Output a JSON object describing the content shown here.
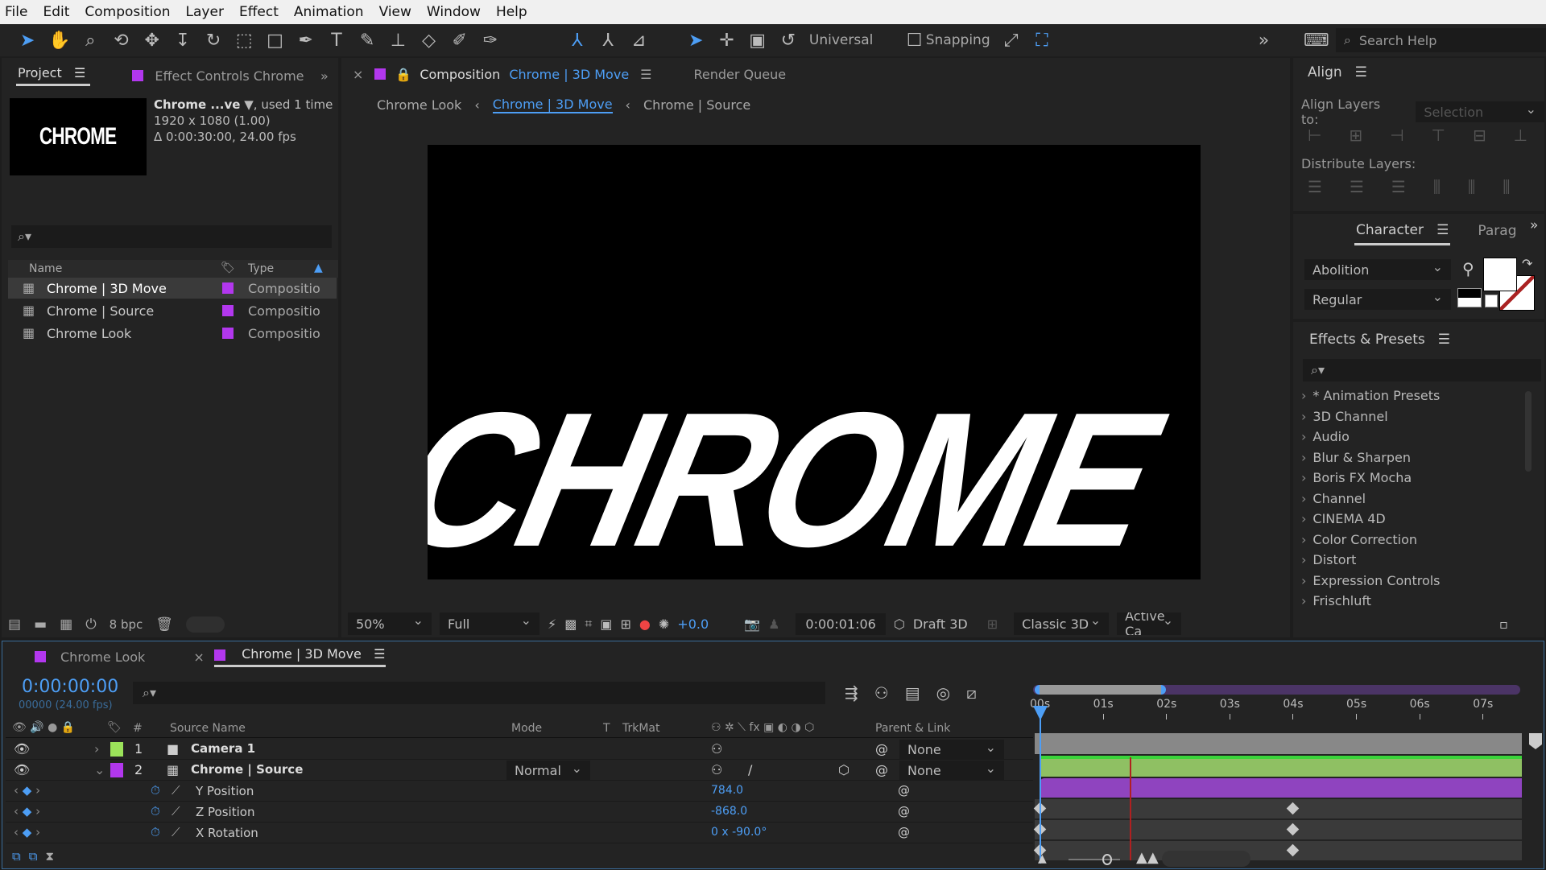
{
  "menu": [
    "File",
    "Edit",
    "Composition",
    "Layer",
    "Effect",
    "Animation",
    "View",
    "Window",
    "Help"
  ],
  "toolbar": {
    "universal": "Universal",
    "snapping": "Snapping",
    "search_placeholder": "Search Help"
  },
  "project": {
    "tab": "Project",
    "effect_controls_tab": "Effect Controls Chrome",
    "thumb_text": "CHROME",
    "info": {
      "name": "Chrome ...ve",
      "used": ", used 1 time",
      "size": "1920 x 1080 (1.00)",
      "duration": "Δ 0:00:30:00, 24.00 fps"
    },
    "columns": {
      "name": "Name",
      "type": "Type"
    },
    "items": [
      {
        "name": "Chrome | 3D Move",
        "type": "Compositio",
        "selected": true
      },
      {
        "name": "Chrome | Source",
        "type": "Compositio"
      },
      {
        "name": "Chrome Look",
        "type": "Compositio"
      }
    ],
    "bpc": "8 bpc"
  },
  "viewer": {
    "tab_prefix": "Composition",
    "tab_name": "Chrome | 3D Move",
    "render_queue": "Render Queue",
    "breadcrumbs": [
      "Chrome Look",
      "Chrome | 3D Move",
      "Chrome | Source"
    ],
    "canvas_text": "CHROME",
    "zoom": "50%",
    "resolution": "Full",
    "exposure": "+0.0",
    "timecode": "0:00:01:06",
    "draft3d": "Draft 3D",
    "renderer": "Classic 3D",
    "view": "Active Ca"
  },
  "align": {
    "title": "Align",
    "align_to": "Align Layers to:",
    "align_to_value": "Selection",
    "distribute": "Distribute Layers:"
  },
  "character": {
    "tab": "Character",
    "para_tab": "Parag",
    "font": "Abolition",
    "style": "Regular",
    "fill": "#ffffff"
  },
  "effects": {
    "title": "Effects & Presets",
    "items": [
      "* Animation Presets",
      "3D Channel",
      "Audio",
      "Blur & Sharpen",
      "Boris FX Mocha",
      "Channel",
      "CINEMA 4D",
      "Color Correction",
      "Distort",
      "Expression Controls",
      "Frischluft"
    ]
  },
  "timeline": {
    "tabs": [
      "Chrome Look",
      "Chrome | 3D Move"
    ],
    "current_time": "0:00:00:00",
    "frame_info": "00000 (24.00 fps)",
    "columns": {
      "num": "#",
      "source": "Source Name",
      "mode": "Mode",
      "t": "T",
      "trkmat": "TrkMat",
      "parent": "Parent & Link"
    },
    "layers": [
      {
        "num": "1",
        "name": "Camera 1",
        "mode": "",
        "parent": "None",
        "color": "#9be35a"
      },
      {
        "num": "2",
        "name": "Chrome | Source",
        "mode": "Normal",
        "parent": "None",
        "color": "#b237ee"
      }
    ],
    "properties": [
      {
        "name": "Y Position",
        "value": "784.0"
      },
      {
        "name": "Z Position",
        "value": "-868.0"
      },
      {
        "name": "X Rotation",
        "value": "0 x -90.0°"
      }
    ],
    "ruler": [
      "00s",
      "01s",
      "02s",
      "03s",
      "04s",
      "05s",
      "06s",
      "07s"
    ],
    "keyframe_times_s": [
      0,
      4
    ],
    "playhead_s": 0,
    "work_area_end_s": 2
  }
}
